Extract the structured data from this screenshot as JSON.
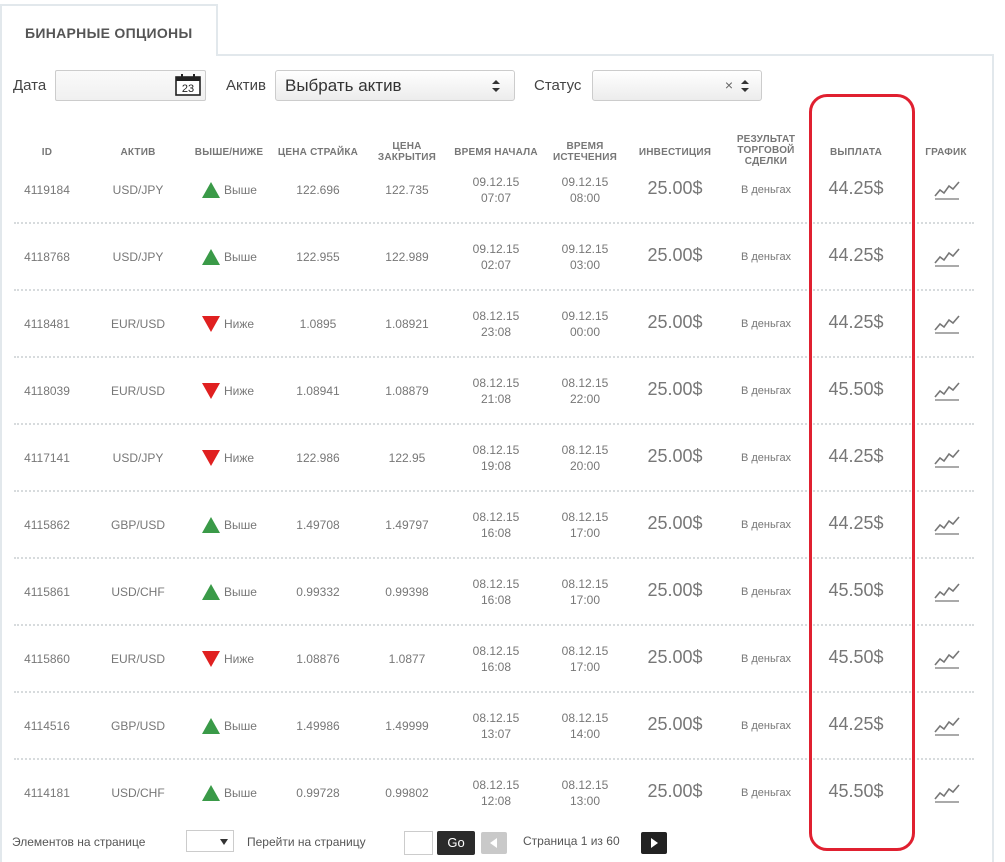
{
  "tab": {
    "title": "БИНАРНЫЕ ОПЦИОНЫ"
  },
  "filters": {
    "date_label": "Дата",
    "date_value": "",
    "calendar_day": "23",
    "asset_label": "Актив",
    "asset_value": "Выбрать актив",
    "status_label": "Статус",
    "status_value": "",
    "status_clear": "×"
  },
  "columns": {
    "id": "ID",
    "asset": "АКТИВ",
    "direction": "ВЫШЕ/НИЖЕ",
    "strike": "ЦЕНА СТРАЙКА",
    "close_1": "ЦЕНА",
    "close_2": "ЗАКРЫТИЯ",
    "start": "ВРЕМЯ НАЧАЛА",
    "expiry_1": "ВРЕМЯ",
    "expiry_2": "ИСТЕЧЕНИЯ",
    "investment": "ИНВЕСТИЦИЯ",
    "result_1": "РЕЗУЛЬТАТ",
    "result_2": "ТОРГОВОЙ",
    "result_3": "СДЕЛКИ",
    "payout": "ВЫПЛАТА",
    "chart": "ГРАФИК"
  },
  "colors": {
    "up": "#3a9a48",
    "down": "#e02020",
    "highlight": "#e02030"
  },
  "rows": [
    {
      "id": "4119184",
      "asset": "USD/JPY",
      "dir": "up",
      "dir_label": "Выше",
      "strike": "122.696",
      "close": "122.735",
      "start_date": "09.12.15",
      "start_time": "07:07",
      "exp_date": "09.12.15",
      "exp_time": "08:00",
      "investment": "25.00$",
      "result": "В деньгах",
      "payout": "44.25$",
      "chart_icon": "chart-icon"
    },
    {
      "id": "4118768",
      "asset": "USD/JPY",
      "dir": "up",
      "dir_label": "Выше",
      "strike": "122.955",
      "close": "122.989",
      "start_date": "09.12.15",
      "start_time": "02:07",
      "exp_date": "09.12.15",
      "exp_time": "03:00",
      "investment": "25.00$",
      "result": "В деньгах",
      "payout": "44.25$",
      "chart_icon": "chart-icon"
    },
    {
      "id": "4118481",
      "asset": "EUR/USD",
      "dir": "down",
      "dir_label": "Ниже",
      "strike": "1.0895",
      "close": "1.08921",
      "start_date": "08.12.15",
      "start_time": "23:08",
      "exp_date": "09.12.15",
      "exp_time": "00:00",
      "investment": "25.00$",
      "result": "В деньгах",
      "payout": "44.25$",
      "chart_icon": "chart-icon"
    },
    {
      "id": "4118039",
      "asset": "EUR/USD",
      "dir": "down",
      "dir_label": "Ниже",
      "strike": "1.08941",
      "close": "1.08879",
      "start_date": "08.12.15",
      "start_time": "21:08",
      "exp_date": "08.12.15",
      "exp_time": "22:00",
      "investment": "25.00$",
      "result": "В деньгах",
      "payout": "45.50$",
      "chart_icon": "chart-icon"
    },
    {
      "id": "4117141",
      "asset": "USD/JPY",
      "dir": "down",
      "dir_label": "Ниже",
      "strike": "122.986",
      "close": "122.95",
      "start_date": "08.12.15",
      "start_time": "19:08",
      "exp_date": "08.12.15",
      "exp_time": "20:00",
      "investment": "25.00$",
      "result": "В деньгах",
      "payout": "44.25$",
      "chart_icon": "chart-icon"
    },
    {
      "id": "4115862",
      "asset": "GBP/USD",
      "dir": "up",
      "dir_label": "Выше",
      "strike": "1.49708",
      "close": "1.49797",
      "start_date": "08.12.15",
      "start_time": "16:08",
      "exp_date": "08.12.15",
      "exp_time": "17:00",
      "investment": "25.00$",
      "result": "В деньгах",
      "payout": "44.25$",
      "chart_icon": "chart-icon"
    },
    {
      "id": "4115861",
      "asset": "USD/CHF",
      "dir": "up",
      "dir_label": "Выше",
      "strike": "0.99332",
      "close": "0.99398",
      "start_date": "08.12.15",
      "start_time": "16:08",
      "exp_date": "08.12.15",
      "exp_time": "17:00",
      "investment": "25.00$",
      "result": "В деньгах",
      "payout": "45.50$",
      "chart_icon": "chart-icon"
    },
    {
      "id": "4115860",
      "asset": "EUR/USD",
      "dir": "down",
      "dir_label": "Ниже",
      "strike": "1.08876",
      "close": "1.0877",
      "start_date": "08.12.15",
      "start_time": "16:08",
      "exp_date": "08.12.15",
      "exp_time": "17:00",
      "investment": "25.00$",
      "result": "В деньгах",
      "payout": "45.50$",
      "chart_icon": "chart-icon"
    },
    {
      "id": "4114516",
      "asset": "GBP/USD",
      "dir": "up",
      "dir_label": "Выше",
      "strike": "1.49986",
      "close": "1.49999",
      "start_date": "08.12.15",
      "start_time": "13:07",
      "exp_date": "08.12.15",
      "exp_time": "14:00",
      "investment": "25.00$",
      "result": "В деньгах",
      "payout": "44.25$",
      "chart_icon": "chart-icon"
    },
    {
      "id": "4114181",
      "asset": "USD/CHF",
      "dir": "up",
      "dir_label": "Выше",
      "strike": "0.99728",
      "close": "0.99802",
      "start_date": "08.12.15",
      "start_time": "12:08",
      "exp_date": "08.12.15",
      "exp_time": "13:00",
      "investment": "25.00$",
      "result": "В деньгах",
      "payout": "45.50$",
      "chart_icon": "chart-icon"
    }
  ],
  "footer": {
    "per_page_label": "Элементов на странице",
    "per_page_value": "",
    "goto_label": "Перейти на страницу",
    "goto_value": "",
    "go_button": "Go",
    "page_info": "Страница 1 из 60"
  }
}
